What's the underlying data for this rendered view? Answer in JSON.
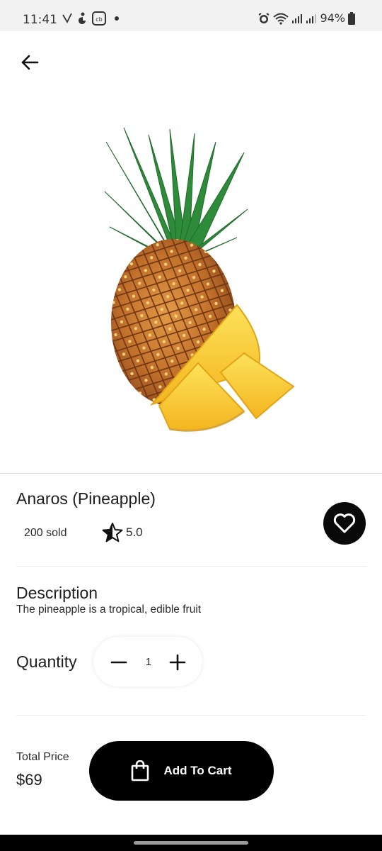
{
  "status_bar": {
    "time": "11:41",
    "battery": "94%"
  },
  "product": {
    "name": "Anaros (Pineapple)",
    "sold": "200 sold",
    "rating": "5.0",
    "image_icon": "pineapple-image"
  },
  "description": {
    "heading": "Description",
    "text": "The pineapple is a tropical, edible fruit"
  },
  "quantity": {
    "label": "Quantity",
    "value": "1"
  },
  "checkout": {
    "total_label": "Total Price",
    "total_value": "$69",
    "button_label": "Add To Cart"
  },
  "colors": {
    "primary": "#000000",
    "background": "#ffffff",
    "pineapple_leaf": "#2e8b3a",
    "pineapple_body": "#c2702a",
    "pineapple_slice": "#f7c72c"
  }
}
